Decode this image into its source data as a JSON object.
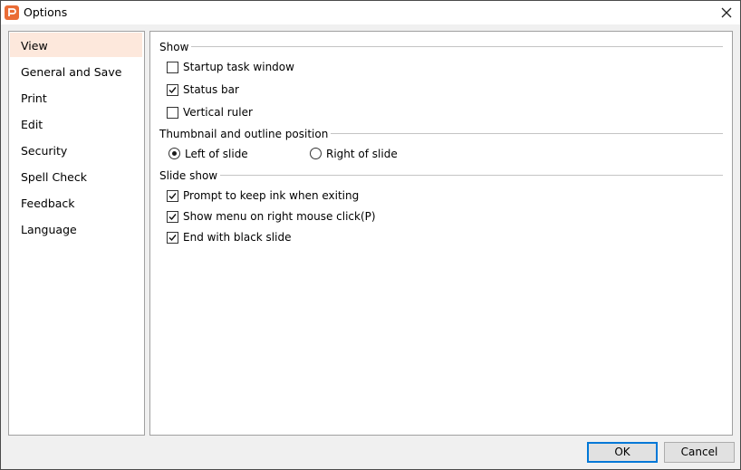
{
  "window": {
    "title": "Options",
    "app_icon": "presentation-app-icon",
    "close_icon": "close-icon"
  },
  "sidebar": {
    "items": [
      {
        "label": "View",
        "selected": true
      },
      {
        "label": "General and Save",
        "selected": false
      },
      {
        "label": "Print",
        "selected": false
      },
      {
        "label": "Edit",
        "selected": false
      },
      {
        "label": "Security",
        "selected": false
      },
      {
        "label": "Spell Check",
        "selected": false
      },
      {
        "label": "Feedback",
        "selected": false
      },
      {
        "label": "Language",
        "selected": false
      }
    ]
  },
  "view": {
    "show": {
      "title": "Show",
      "options": [
        {
          "label": "Startup task window",
          "checked": false
        },
        {
          "label": "Status bar",
          "checked": true
        },
        {
          "label": "Vertical ruler",
          "checked": false
        }
      ]
    },
    "thumbnail": {
      "title": "Thumbnail and outline position",
      "options": [
        {
          "label": "Left of slide",
          "selected": true
        },
        {
          "label": "Right of slide",
          "selected": false
        }
      ]
    },
    "slideshow": {
      "title": "Slide show",
      "options": [
        {
          "label": "Prompt to keep ink when exiting",
          "checked": true
        },
        {
          "label": "Show menu on right mouse click(P)",
          "checked": true
        },
        {
          "label": "End with black slide",
          "checked": true
        }
      ]
    }
  },
  "buttons": {
    "ok": "OK",
    "cancel": "Cancel"
  },
  "colors": {
    "accent": "#ea6c36",
    "selection": "#fde8dc",
    "focus_border": "#0078d7"
  }
}
